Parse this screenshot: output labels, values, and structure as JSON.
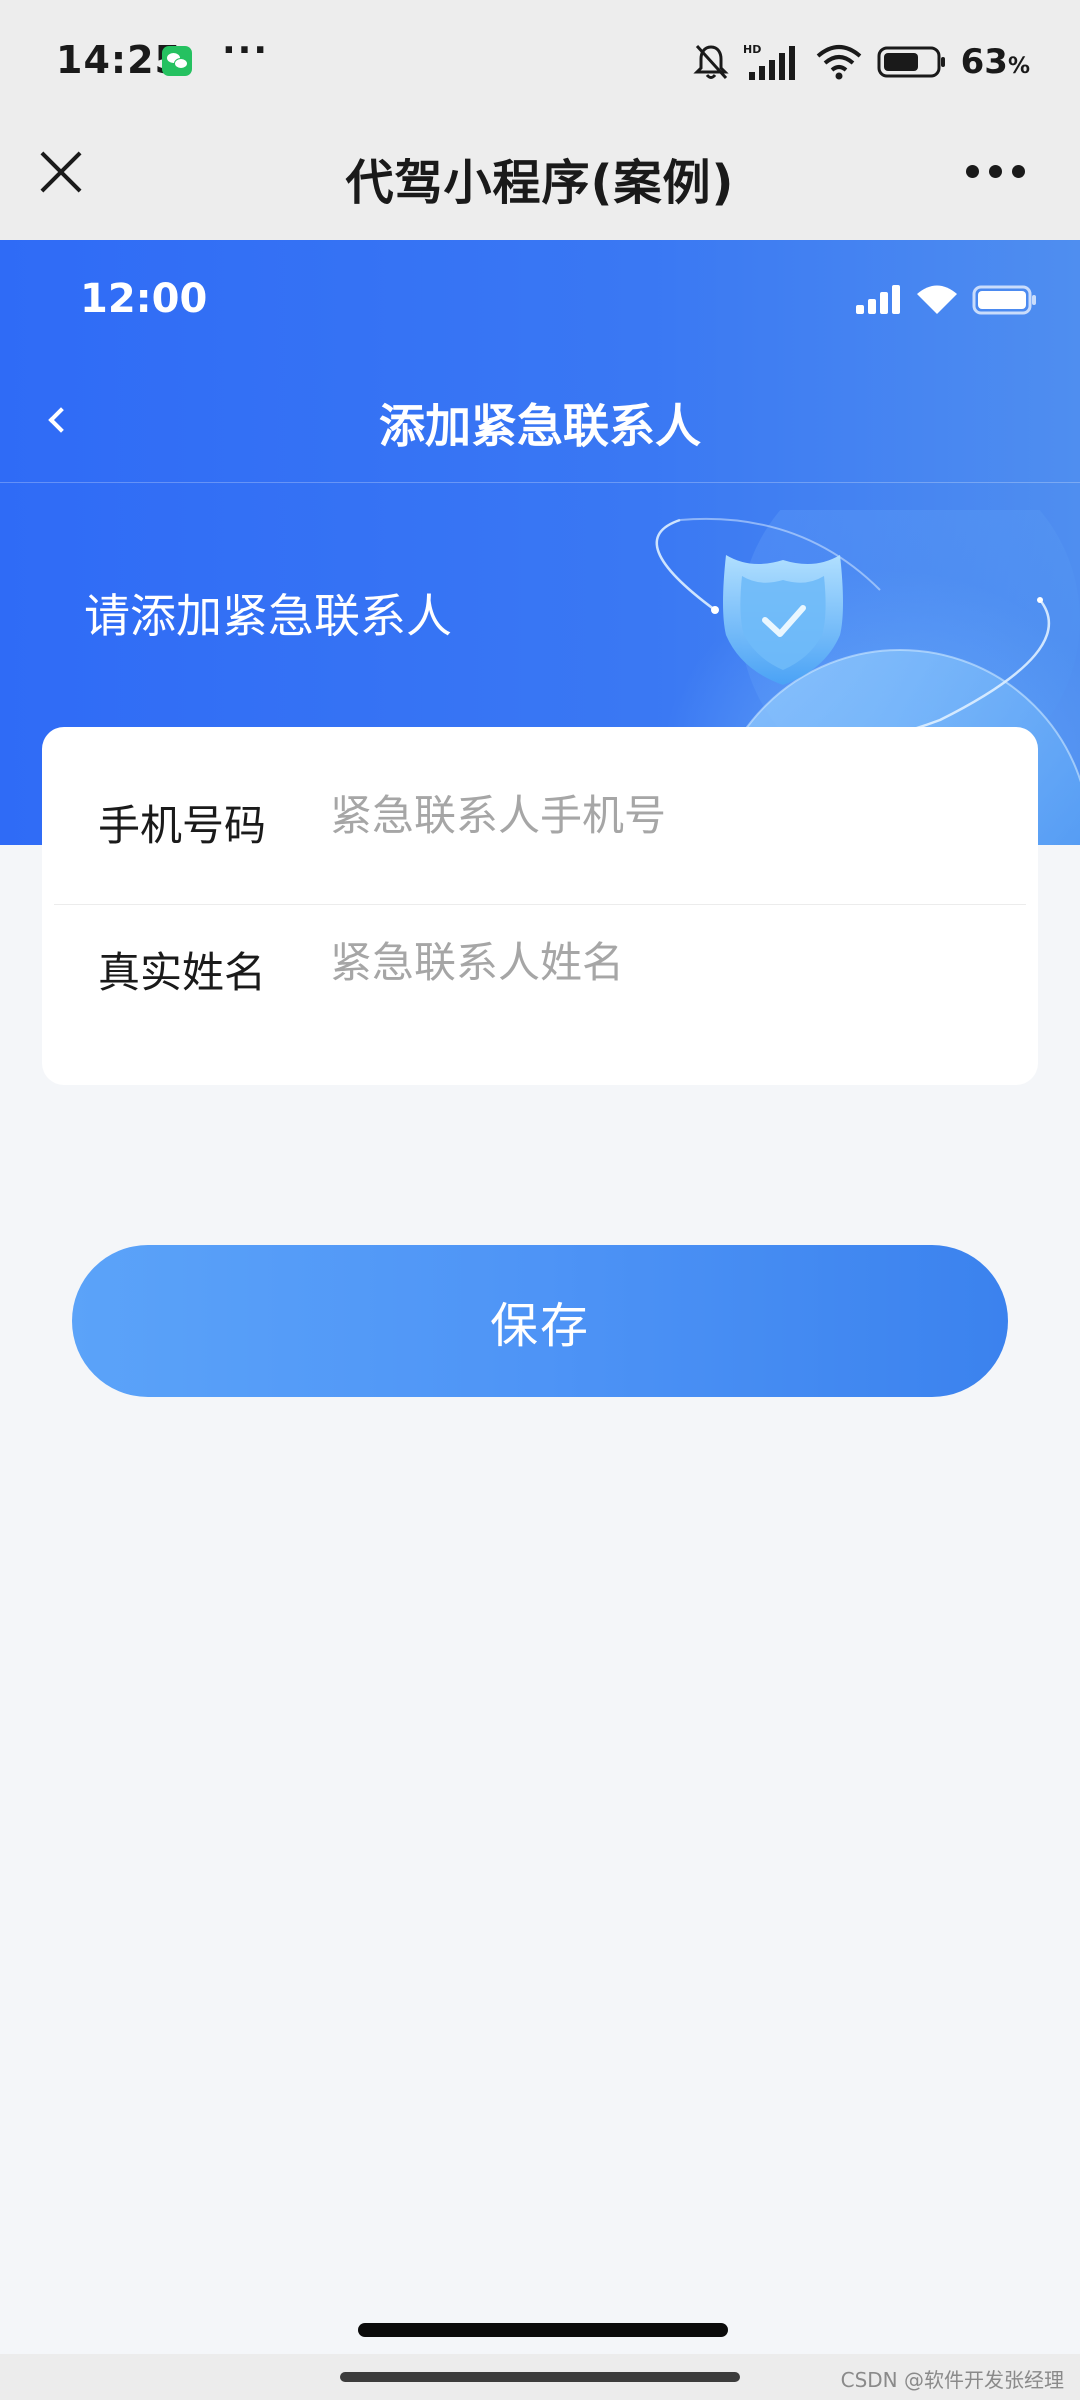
{
  "os_status": {
    "time": "14:25",
    "overflow": "···",
    "battery_pct": "63",
    "battery_unit": "%",
    "icons": [
      "wechat-icon",
      "bell-muted-icon",
      "hd-signal-icon",
      "wifi-icon",
      "battery-icon"
    ]
  },
  "miniprogram": {
    "title": "代驾小程序(案例)"
  },
  "page": {
    "status_time": "12:00",
    "title": "添加紧急联系人",
    "subtitle": "请添加紧急联系人"
  },
  "form": {
    "phone_label": "手机号码",
    "phone_placeholder": "紧急联系人手机号",
    "phone_value": "",
    "name_label": "真实姓名",
    "name_placeholder": "紧急联系人姓名",
    "name_value": ""
  },
  "actions": {
    "save_label": "保存"
  },
  "footer": {
    "watermark": "CSDN @软件开发张经理"
  },
  "colors": {
    "primary_blue": "#2f6bf6",
    "button_blue": "#4e94f6",
    "page_bg": "#f4f6f9",
    "chrome_bg": "#ededed"
  }
}
